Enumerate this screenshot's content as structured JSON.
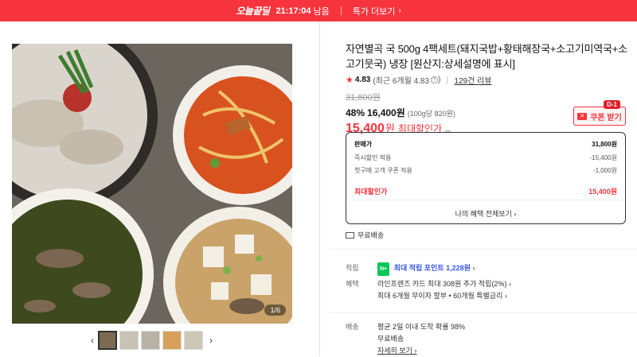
{
  "topbar": {
    "deal_logo": "오늘끝딜",
    "timer": "21:17:04",
    "timer_suffix": "남음",
    "more": "특가 더보기"
  },
  "gallery": {
    "counter": "1/6",
    "thumbnail_count": 5
  },
  "product": {
    "title": "자연별곡 국 500g 4팩세트(돼지국밥+황태해장국+소고기미역국+소고기뭇국) 냉장 [원산지:상세설명에 표시]",
    "rating": "4.83",
    "rating_detail": "(최근 6개월 4.83",
    "review_link": "129건 리뷰",
    "original_price": "31,800원",
    "discount_pct": "48%",
    "sale_price": "16,400원",
    "unit_price": "(100g당 820원)",
    "max_price": "15,400",
    "max_won": "원",
    "max_label": "최대할인가"
  },
  "coupon": {
    "badge": "D-1",
    "label": "쿠폰 받기"
  },
  "pricebox": {
    "rows": [
      {
        "label": "판매가",
        "value": "31,800원"
      },
      {
        "label": "즉시할인 적용",
        "value": "-15,400원"
      },
      {
        "label": "첫구매 고객 쿠폰 적용",
        "value": "-1,000원"
      }
    ],
    "total": {
      "label": "최대할인가",
      "value": "15,400원"
    },
    "benefits": "나의 혜택 전체보기"
  },
  "shipping_top": "무료배송",
  "info": {
    "points_label": "적립",
    "points_prefix": "최대 적립 포인트",
    "points_value": "1,228원",
    "benefit_label": "혜택",
    "benefit_1": "라인프렌즈 카드 최대 308원 추가 적립(2%)",
    "benefit_2": "최대 6개월 무이자 할부 • 60개월 특별금리",
    "delivery_label": "배송",
    "delivery_1": "평균 2일 이내 도착 확률 98%",
    "delivery_2": "무료배송",
    "delivery_more": "자세히 보기"
  },
  "colors": {
    "accent": "#f7343e",
    "points": "#3754e3",
    "npay": "#03c75a"
  }
}
